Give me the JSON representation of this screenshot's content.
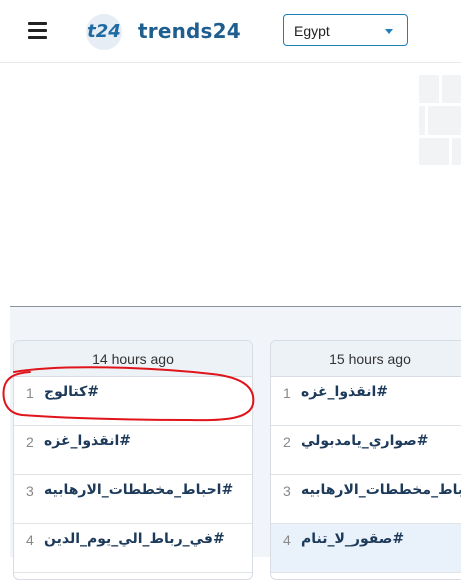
{
  "header": {
    "logo_badge": "t24",
    "brand": "trends24",
    "country": {
      "selected": "Egypt"
    }
  },
  "columns": [
    {
      "time": "14 hours ago",
      "trends": [
        {
          "rank": "1",
          "tag": "#كتالوج"
        },
        {
          "rank": "2",
          "tag": "#انقذوا_غزه"
        },
        {
          "rank": "3",
          "tag": "#احباط_مخططات_الارهابيه"
        },
        {
          "rank": "4",
          "tag": "#في_رباط_الي_يوم_الدين"
        }
      ]
    },
    {
      "time": "15 hours ago",
      "trends": [
        {
          "rank": "1",
          "tag": "#انقذوا_غزه"
        },
        {
          "rank": "2",
          "tag": "#صواري_يامدبولي"
        },
        {
          "rank": "3",
          "tag": "#احباط_مخططات_الارهابيه"
        },
        {
          "rank": "4",
          "tag": "#صقور_لا_تنام"
        }
      ]
    }
  ],
  "colors": {
    "accent": "#1f7fb8",
    "brand": "#1f5f8f",
    "annotation": "#e0141b"
  }
}
